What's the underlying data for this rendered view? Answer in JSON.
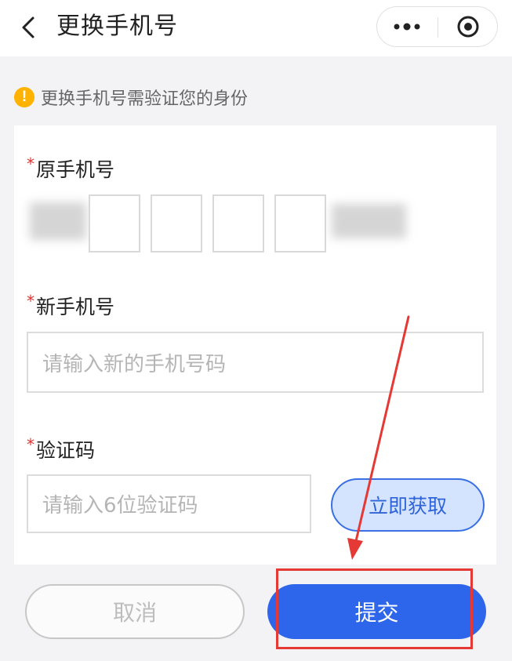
{
  "header": {
    "title": "更换手机号",
    "back_icon": "chevron-left-icon",
    "more_icon": "more-dots-icon",
    "close_icon": "target-circle-icon"
  },
  "notice": {
    "icon": "exclamation-icon",
    "icon_glyph": "!",
    "text": "更换手机号需验证您的身份",
    "color": "#ffb300"
  },
  "form": {
    "original_phone": {
      "required_mark": "*",
      "label": "原手机号"
    },
    "new_phone": {
      "required_mark": "*",
      "label": "新手机号",
      "placeholder": "请输入新的手机号码"
    },
    "code": {
      "required_mark": "*",
      "label": "验证码",
      "placeholder": "请输入6位验证码",
      "get_code_label": "立即获取"
    }
  },
  "actions": {
    "cancel_label": "取消",
    "submit_label": "提交"
  },
  "colors": {
    "primary": "#2d66ea",
    "required": "#e03131",
    "annotation": "#e53935"
  }
}
